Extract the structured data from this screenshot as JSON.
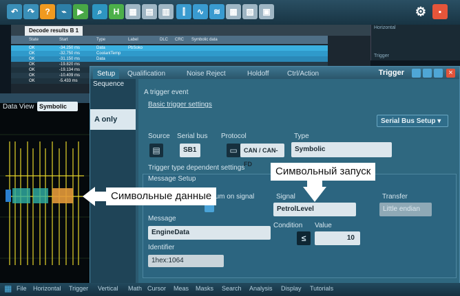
{
  "decode_window": {
    "tab_label": "Decode results B 1",
    "columns": [
      "State",
      "Start",
      "Type",
      "Label",
      "DLC",
      "CRC",
      "Symbolic data"
    ],
    "rows": [
      {
        "state": "OK",
        "start": "-34.250 ms",
        "type": "Data",
        "label": "PbSoko"
      },
      {
        "state": "OK",
        "start": "-32.750 ms",
        "type": "CoolantTemp",
        "label": ""
      },
      {
        "state": "OK",
        "start": "-31.150 ms",
        "type": "Data",
        "label": ""
      },
      {
        "state": "OK",
        "start": "-19.820 ms",
        "type": "",
        "label": ""
      },
      {
        "state": "OK",
        "start": "-19.134 ms",
        "type": "",
        "label": ""
      },
      {
        "state": "OK",
        "start": "-10.409 ms",
        "type": "",
        "label": ""
      },
      {
        "state": "OK",
        "start": "-5.433 ms",
        "type": "",
        "label": ""
      }
    ]
  },
  "right_panel": [
    "Horizontal",
    "Trigger"
  ],
  "left_panel": {
    "data_view_label": "Data View",
    "data_view_value": "Symbolic"
  },
  "dialog": {
    "title": "Trigger",
    "tabs": [
      "Setup",
      "Qualification",
      "Noise Reject",
      "Holdoff",
      "Ctrl/Action"
    ],
    "sequence_label": "Sequence",
    "sequence_item": "A only",
    "a_trigger_event": "A trigger event",
    "basic_settings": "Basic trigger settings",
    "serial_bus_setup": "Serial Bus Setup",
    "source_label": "Source",
    "serial_bus_label": "Serial bus",
    "serial_bus_value": "SB1",
    "protocol_label": "Protocol",
    "protocol_value": "CAN / CAN-FD",
    "type_label": "Type",
    "type_value": "Symbolic",
    "dependent_settings": "Trigger type dependent settings",
    "message_setup": "Message Setup",
    "enum_label": "num on signal",
    "message_label": "Message",
    "message_value": "EngineData",
    "identifier_label": "Identifier",
    "identifier_value": "1hex:1064",
    "signal_label": "Signal",
    "signal_value": "PetrolLevel",
    "transfer_label": "Transfer",
    "transfer_value": "Little endian",
    "condition_label": "Condition",
    "condition_symbol": "≤",
    "value_label": "Value",
    "value_value": "10"
  },
  "callouts": {
    "symbolic_trigger": "Символьный запуск",
    "symbolic_data": "Символьные данные"
  },
  "menu": [
    "File",
    "Horizontal",
    "Trigger",
    "Vertical",
    "Math",
    "Cursor",
    "Meas",
    "Masks",
    "Search",
    "Analysis",
    "Display",
    "Tutorials"
  ]
}
